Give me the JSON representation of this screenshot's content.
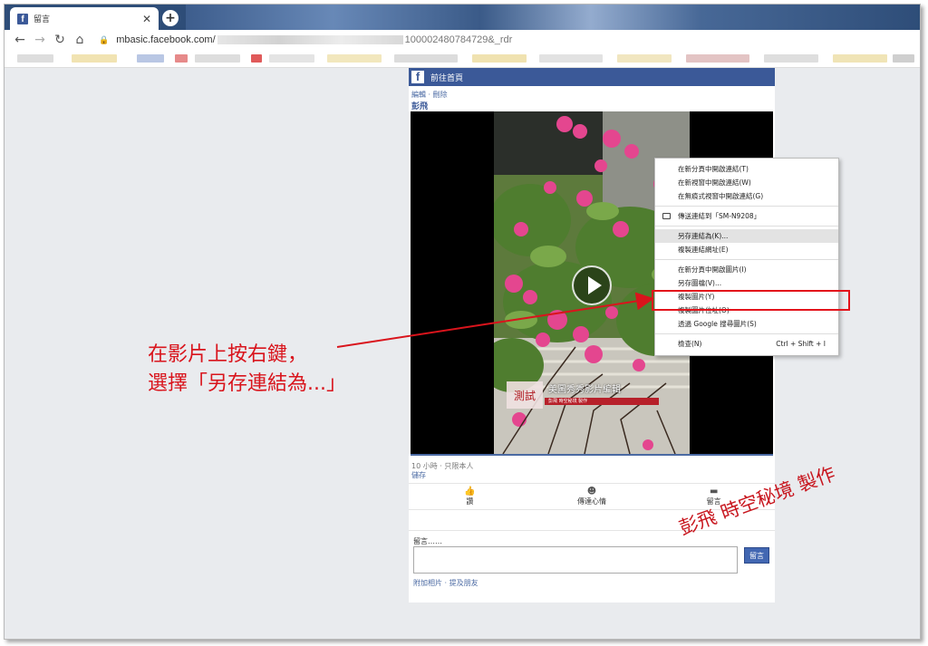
{
  "browser": {
    "tab_title": "留言",
    "tab_icon": "facebook-favicon-icon",
    "new_tab": "+",
    "url_host": "mbasic.facebook.com/",
    "url_tail": "100002480784729&_rdr"
  },
  "page": {
    "home_link": "前往首頁",
    "edit_links": "編輯 · 刪除",
    "poster": "彭飛",
    "video": {
      "tag_test": "測試",
      "tag_title": "美圖秀秀影片編輯",
      "tag_sub": "彭飛 時空秘境 製作"
    },
    "meta": "10 小時 · 只限本人",
    "save": "儲存",
    "actions": [
      {
        "icon": "thumbs-up-icon",
        "label": "讚"
      },
      {
        "icon": "emoji-icon",
        "label": "傳達心情"
      },
      {
        "icon": "comment-icon",
        "label": "留言"
      }
    ],
    "comment_label": "留言……",
    "comment_button": "留言",
    "comment_links": "附加相片 · 提及朋友"
  },
  "context_menu": {
    "items": [
      "在新分頁中開啟連結(T)",
      "在新視窗中開啟連結(W)",
      "在無痕式視窗中開啟連結(G)",
      "傳送連結到「SM-N9208」",
      "另存連結為(K)...",
      "複製連結網址(E)",
      "在新分頁中開啟圖片(I)",
      "另存圖檔(V)...",
      "複製圖片(Y)",
      "複製圖片位址(O)",
      "透過 Google 搜尋圖片(S)",
      "檢查(N)"
    ],
    "inspect_shortcut": "Ctrl + Shift + I",
    "highlighted_index": 4
  },
  "annotation": {
    "line1": "在影片上按右鍵，",
    "line2": "選擇「另存連結為...」",
    "color": "#d9141c"
  },
  "signature": "彭飛 時空秘境 製作",
  "colors": {
    "facebook_blue": "#3b5998",
    "highlight_red": "#e3141b",
    "page_bg": "#e9ebee"
  }
}
